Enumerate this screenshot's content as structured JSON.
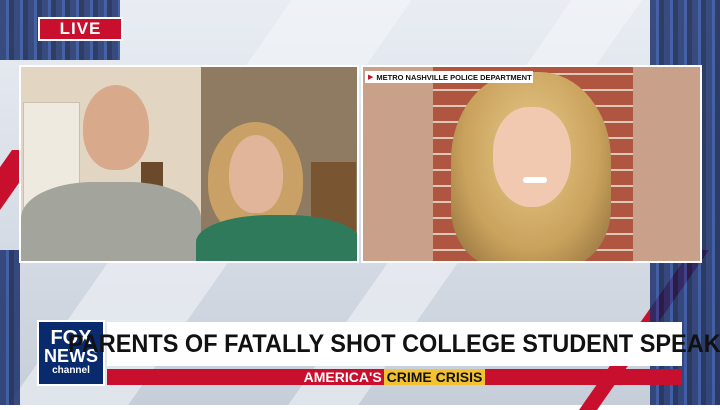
{
  "live_badge": {
    "label": "LIVE"
  },
  "left_feed": {
    "description_people": [
      "father",
      "mother"
    ]
  },
  "photo_credit": {
    "text": "METRO NASHVILLE POLICE DEPARTMENT"
  },
  "logo": {
    "line1": "FOX",
    "line2": "NEWS",
    "line3": "channel"
  },
  "headline": {
    "text": "PARENTS OF FATALLY SHOT COLLEGE STUDENT SPEAK"
  },
  "subbar": {
    "prefix": "AMERICA'S",
    "highlight": "CRIME CRISIS"
  },
  "colors": {
    "brand_red": "#c8102e",
    "brand_navy": "#0a2a6e",
    "highlight_yellow": "#f2c230"
  }
}
